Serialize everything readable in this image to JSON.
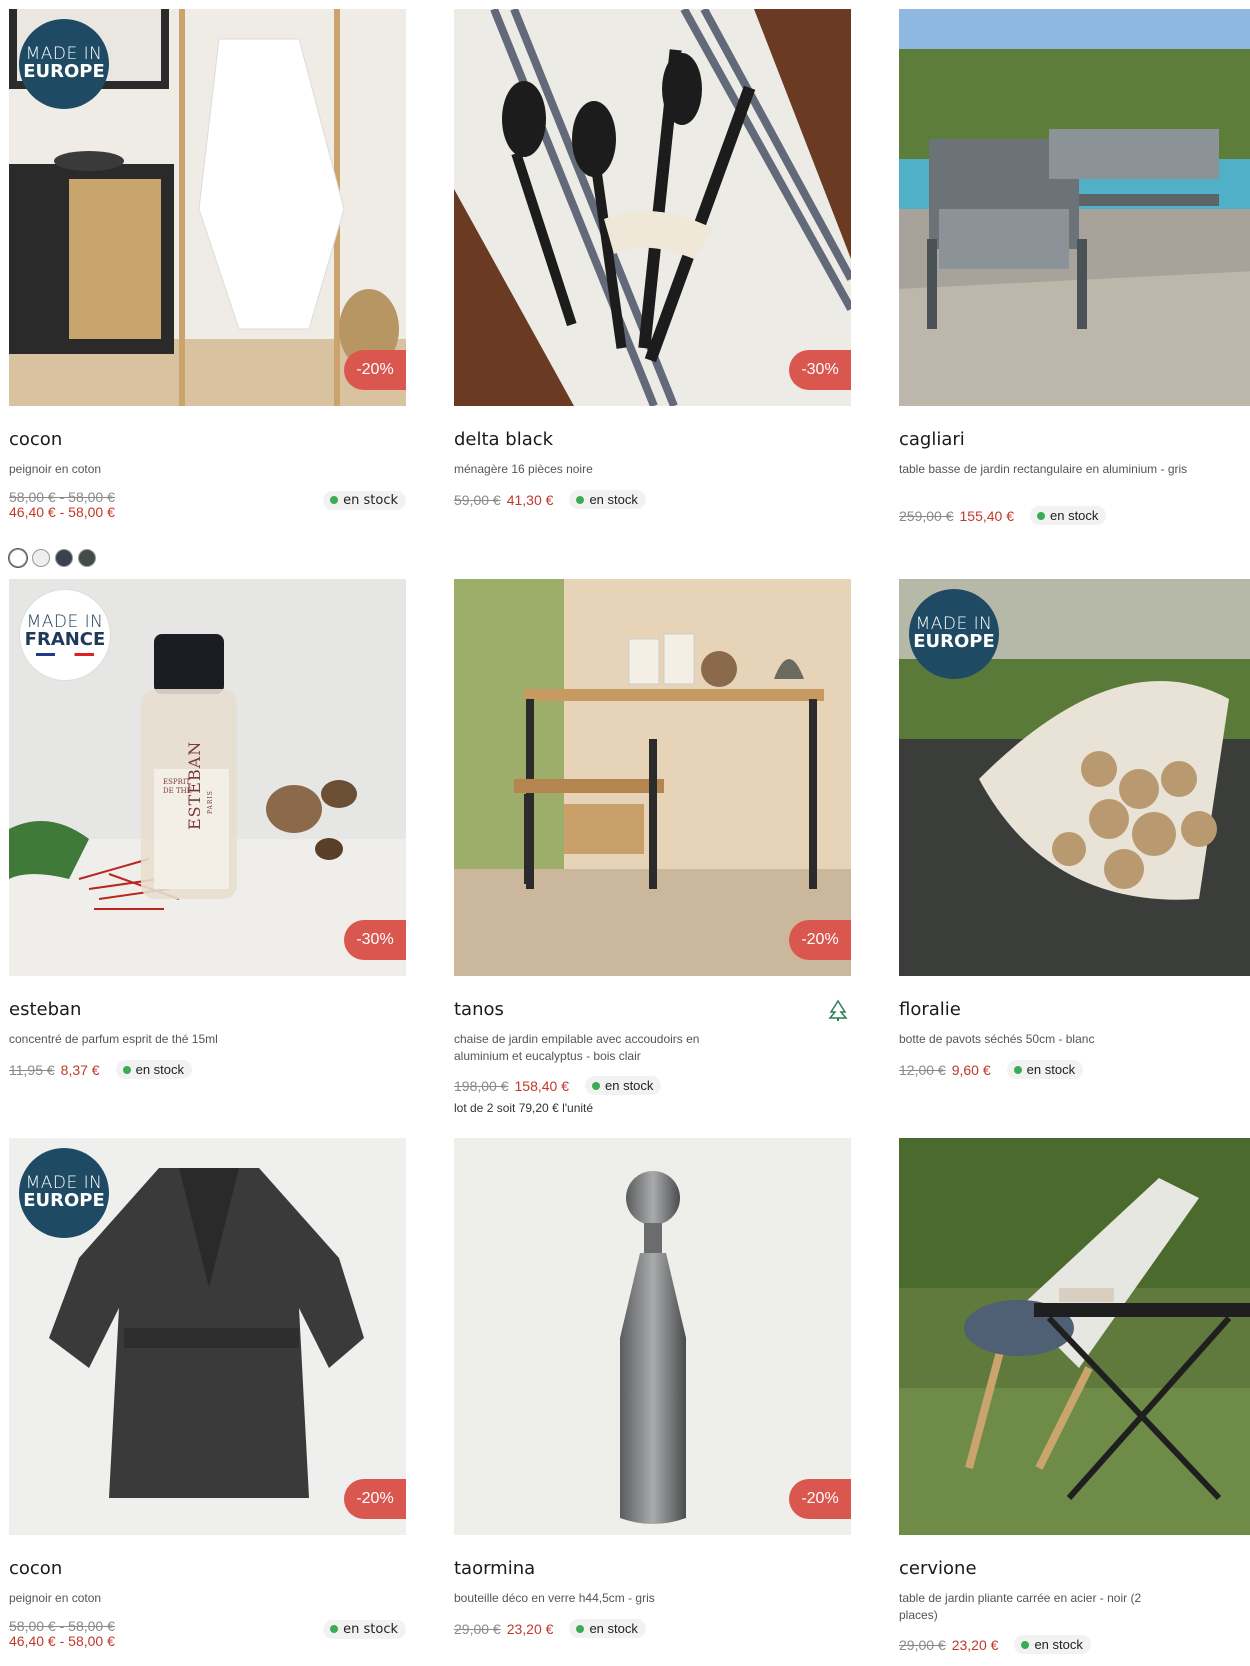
{
  "colors": {
    "discount_badge": "#d9574f",
    "new_price": "#c0392b",
    "stock_dot": "#3cab57",
    "europe_badge": "#1e4a63"
  },
  "products": [
    {
      "title": "cocon",
      "description": "peignoir en coton",
      "old_price": "58,00 € - 58,00 €",
      "new_price": "46,40 € - 58,00 €",
      "stock": "en stock",
      "discount": "-20%",
      "origin_badge": {
        "line1": "MADE IN",
        "line2": "EUROPE"
      },
      "swatches": [
        "#ffffff",
        "#eeeeee",
        "#3a4250",
        "#444c48"
      ],
      "image": "white-bathrobe-on-ladder"
    },
    {
      "title": "delta black",
      "description": "ménagère 16 pièces noire",
      "old_price": "59,00 €",
      "new_price": "41,30 €",
      "stock": "en stock",
      "discount": "-30%",
      "image": "black-cutlery-on-striped-cloth"
    },
    {
      "title": "cagliari",
      "description": "table basse de jardin rectangulaire en aluminium - gris",
      "old_price": "259,00 €",
      "new_price": "155,40 €",
      "stock": "en stock",
      "image": "garden-lounge-by-pool"
    },
    {
      "title": "esteban",
      "description": "concentré de parfum esprit de thé 15ml",
      "old_price": "11,95 €",
      "new_price": "8,37 €",
      "stock": "en stock",
      "discount": "-30%",
      "origin_badge": {
        "line1": "MADE IN",
        "line2": "FRANCE"
      },
      "bottle_label": {
        "line1": "ESPRIT",
        "line2": "DE THÉ",
        "brand": "ESTEBAN",
        "city": "PARIS"
      },
      "image": "perfume-bottle-with-saffron"
    },
    {
      "title": "tanos",
      "description": "chaise de jardin empilable avec accoudoirs en aluminium et eucalyptus - bois clair",
      "old_price": "198,00 €",
      "new_price": "158,40 €",
      "stock": "en stock",
      "discount": "-20%",
      "note": "lot de 2 soit 79,20 € l'unité",
      "certification": "FSC",
      "image": "garden-chair-and-desk"
    },
    {
      "title": "floralie",
      "description": "botte de pavots séchés 50cm - blanc",
      "old_price": "12,00 €",
      "new_price": "9,60 €",
      "stock": "en stock",
      "origin_badge": {
        "line1": "MADE IN",
        "line2": "EUROPE"
      },
      "image": "dried-poppy-bouquet"
    },
    {
      "title": "cocon",
      "description": "peignoir en coton",
      "old_price": "58,00 € - 58,00 €",
      "new_price": "46,40 € - 58,00 €",
      "stock": "en stock",
      "discount": "-20%",
      "origin_badge": {
        "line1": "MADE IN",
        "line2": "EUROPE"
      },
      "image": "dark-grey-bathrobe"
    },
    {
      "title": "taormina",
      "description": "bouteille déco en verre h44,5cm - gris",
      "old_price": "29,00 €",
      "new_price": "23,20 €",
      "stock": "en stock",
      "discount": "-20%",
      "image": "grey-glass-bottle"
    },
    {
      "title": "cervione",
      "description": "table de jardin pliante carrée en acier - noir (2 places)",
      "old_price": "29,00 €",
      "new_price": "23,20 €",
      "stock": "en stock",
      "image": "deck-chair-and-folding-table"
    }
  ]
}
